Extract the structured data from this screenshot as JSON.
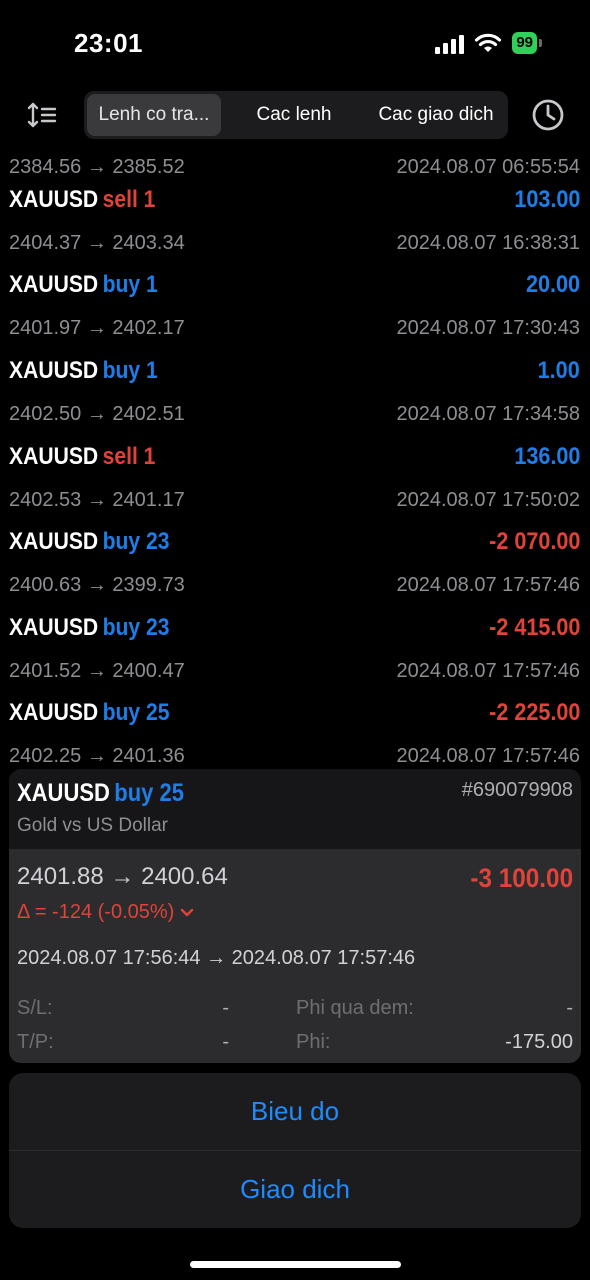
{
  "status_bar": {
    "time": "23:01",
    "battery": "99"
  },
  "toolbar": {
    "tabs": [
      {
        "label": "Lenh co tra..."
      },
      {
        "label": "Cac lenh"
      },
      {
        "label": "Cac giao dich"
      }
    ]
  },
  "partial_row": {
    "prices": "2384.56 → 2385.52",
    "date": "2024.08.07 06:55:54"
  },
  "deals": [
    {
      "symbol": "XAUUSD",
      "side": "sell 1",
      "prices": "2404.37 → 2403.34",
      "profit": "103.00",
      "date": "2024.08.07 16:38:31"
    },
    {
      "symbol": "XAUUSD",
      "side": "buy 1",
      "prices": "2401.97 → 2402.17",
      "profit": "20.00",
      "date": "2024.08.07 17:30:43"
    },
    {
      "symbol": "XAUUSD",
      "side": "buy 1",
      "prices": "2402.50 → 2402.51",
      "profit": "1.00",
      "date": "2024.08.07 17:34:58"
    },
    {
      "symbol": "XAUUSD",
      "side": "sell 1",
      "prices": "2402.53 → 2401.17",
      "profit": "136.00",
      "date": "2024.08.07 17:50:02"
    },
    {
      "symbol": "XAUUSD",
      "side": "buy 23",
      "prices": "2400.63 → 2399.73",
      "profit": "-2 070.00",
      "date": "2024.08.07 17:57:46"
    },
    {
      "symbol": "XAUUSD",
      "side": "buy 23",
      "prices": "2401.52 → 2400.47",
      "profit": "-2 415.00",
      "date": "2024.08.07 17:57:46"
    },
    {
      "symbol": "XAUUSD",
      "side": "buy 25",
      "prices": "2402.25 → 2401.36",
      "profit": "-2 225.00",
      "date": "2024.08.07 17:57:46"
    }
  ],
  "detail": {
    "symbol": "XAUUSD",
    "side": "buy 25",
    "ticket": "#690079908",
    "description": "Gold vs US Dollar",
    "prices": "2401.88 → 2400.64",
    "profit": "-3 100.00",
    "delta": "Δ = -124 (-0.05%)",
    "times": "2024.08.07 17:56:44 → 2024.08.07 17:57:46",
    "sl_label": "S/L:",
    "sl_value": "-",
    "tp_label": "T/P:",
    "tp_value": "-",
    "swap_label": "Phi qua dem:",
    "swap_value": "-",
    "fee_label": "Phi:",
    "fee_value": "-175.00"
  },
  "action_sheet": {
    "chart_label": "Bieu do",
    "trade_label": "Giao dich"
  },
  "colors": {
    "buy": "#1e7de6",
    "sell": "#e0433a",
    "loss": "#e0433a",
    "action": "#1e8cff"
  }
}
